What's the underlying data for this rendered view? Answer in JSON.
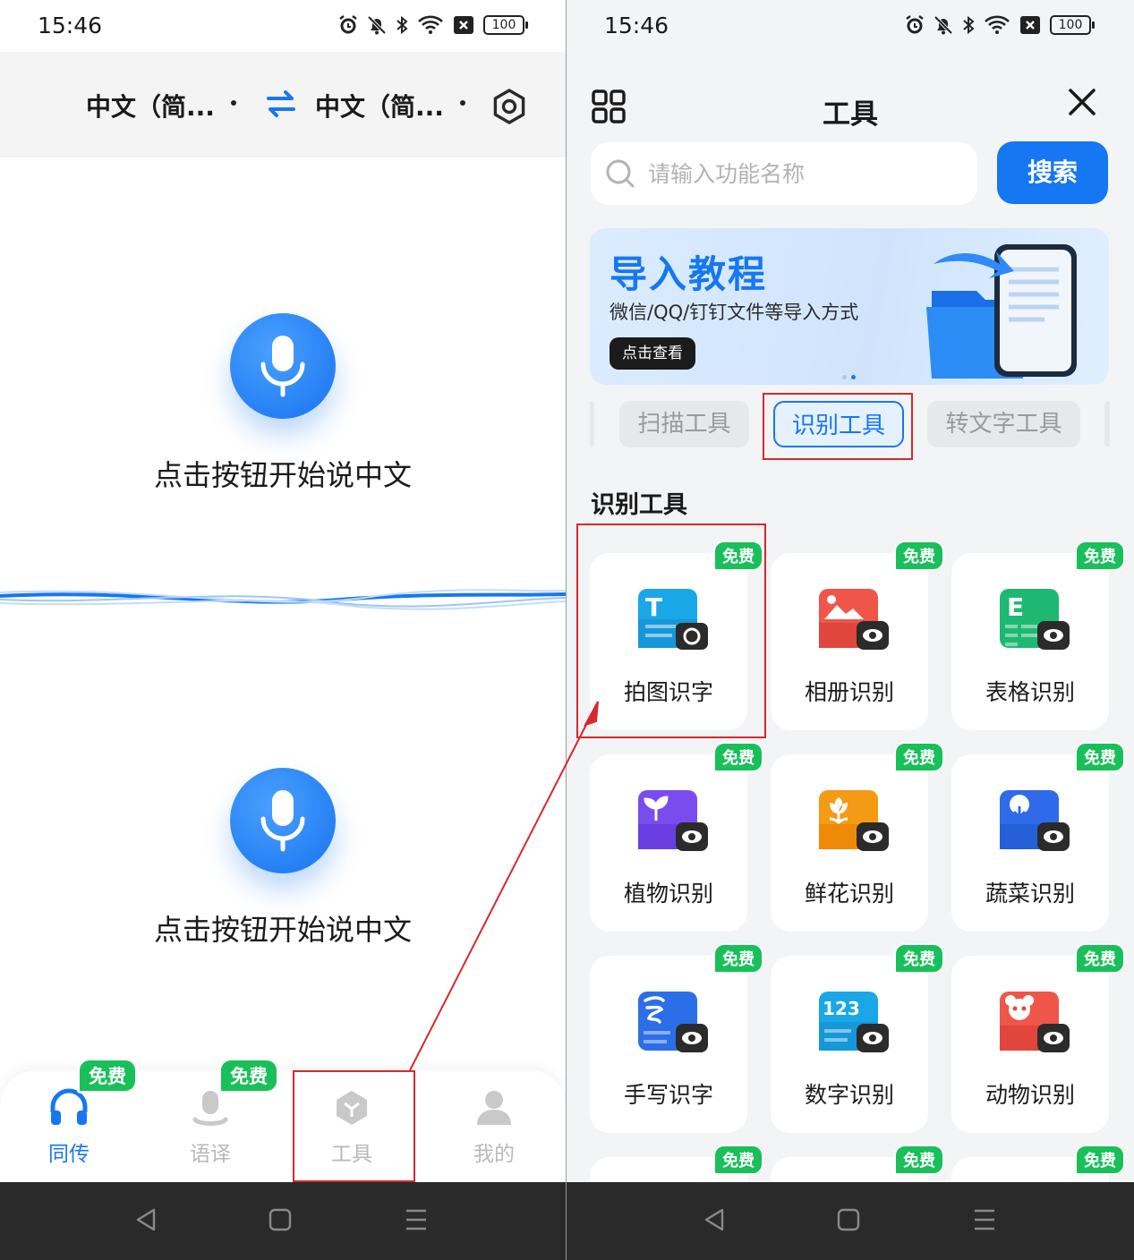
{
  "left": {
    "status": {
      "time": "15:46",
      "battery": "100"
    },
    "topbar": {
      "source_lang": "中文（简...",
      "target_lang": "中文（简..."
    },
    "mic_hint_top": "点击按钮开始说中文",
    "mic_hint_bottom": "点击按钮开始说中文",
    "tabs": [
      {
        "label": "同传",
        "icon": "headphones-icon",
        "badge": "免费",
        "active": true
      },
      {
        "label": "语译",
        "icon": "speaker-person-icon",
        "badge": "免费",
        "active": false
      },
      {
        "label": "工具",
        "icon": "cube-icon",
        "badge": "",
        "active": false
      },
      {
        "label": "我的",
        "icon": "person-icon",
        "badge": "",
        "active": false
      }
    ]
  },
  "right": {
    "status": {
      "time": "15:46",
      "battery": "100"
    },
    "header": {
      "title": "工具"
    },
    "search": {
      "placeholder": "请输入功能名称",
      "button": "搜索"
    },
    "banner": {
      "title": "导入教程",
      "subtitle": "微信/QQ/钉钉文件等导入方式",
      "button": "点击查看"
    },
    "categories": [
      "扫描工具",
      "识别工具",
      "转文字工具"
    ],
    "active_category": "识别工具",
    "section_title": "识别工具",
    "free_label": "免费",
    "tools": [
      {
        "label": "拍图识字",
        "icon": "text-camera-icon",
        "color": "#1aa7e8",
        "glyph": "T"
      },
      {
        "label": "相册识别",
        "icon": "album-eye-icon",
        "color": "#f0554a",
        "glyph": ""
      },
      {
        "label": "表格识别",
        "icon": "table-eye-icon",
        "color": "#1fb872",
        "glyph": "E"
      },
      {
        "label": "植物识别",
        "icon": "plant-eye-icon",
        "color": "#7a4cf0",
        "glyph": ""
      },
      {
        "label": "鲜花识别",
        "icon": "flower-eye-icon",
        "color": "#f59a15",
        "glyph": ""
      },
      {
        "label": "蔬菜识别",
        "icon": "vegetable-eye-icon",
        "color": "#2f6be8",
        "glyph": ""
      },
      {
        "label": "手写识字",
        "icon": "handwriting-eye-icon",
        "color": "#2c6ee8",
        "glyph": ""
      },
      {
        "label": "数字识别",
        "icon": "number-eye-icon",
        "color": "#1aa7e8",
        "glyph": "123"
      },
      {
        "label": "动物识别",
        "icon": "animal-eye-icon",
        "color": "#f0554a",
        "glyph": ""
      }
    ]
  }
}
